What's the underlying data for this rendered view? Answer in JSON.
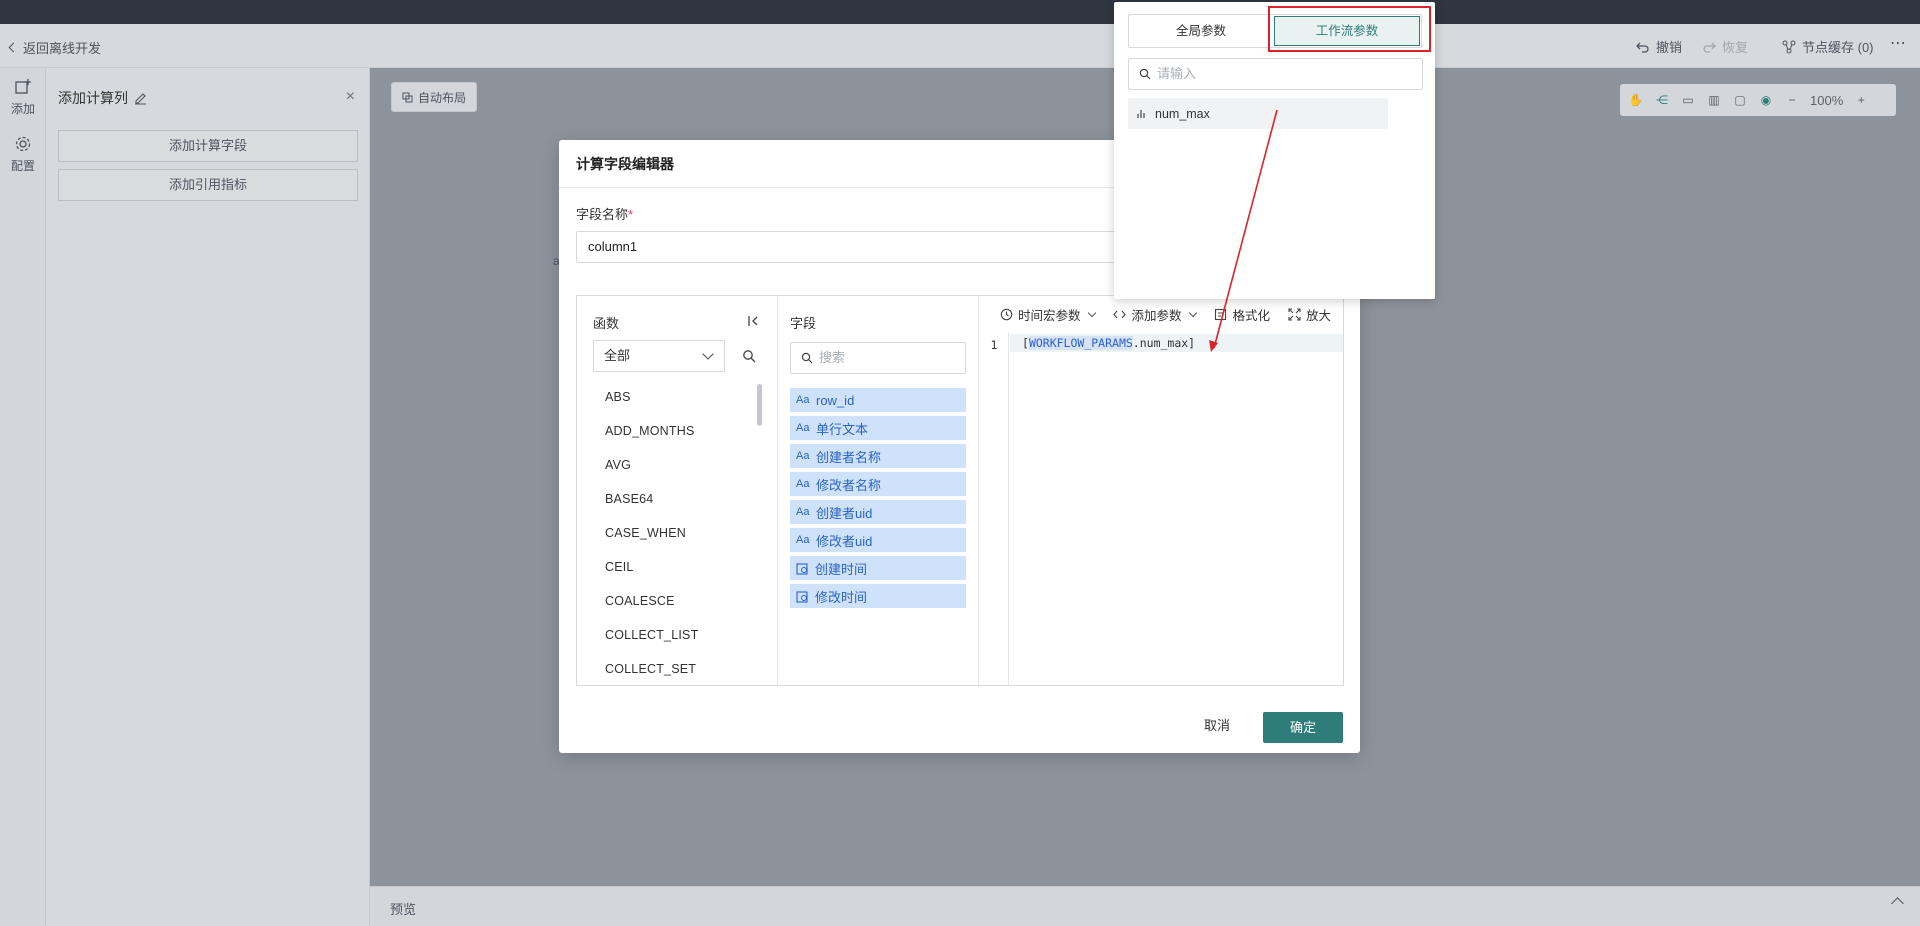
{
  "header": {
    "back_label": "返回离线开发",
    "undo_label": "撤销",
    "redo_label": "恢复",
    "node_cache_label": "节点缓存 (0)"
  },
  "rail": {
    "add_label": "添加",
    "config_label": "配置"
  },
  "left_panel": {
    "title": "添加计算列",
    "buttons": [
      "添加计算字段",
      "添加引用指标"
    ]
  },
  "canvas": {
    "auto_layout_label": "自动布局",
    "zoom_level": "100%",
    "preview_label": "预览"
  },
  "modal": {
    "title": "计算字段编辑器",
    "field_name_label": "字段名称",
    "required_mark": "*",
    "field_name_value": "column1",
    "functions": {
      "title": "函数",
      "category_selected": "全部",
      "items": [
        "ABS",
        "ADD_MONTHS",
        "AVG",
        "BASE64",
        "CASE_WHEN",
        "CEIL",
        "COALESCE",
        "COLLECT_LIST",
        "COLLECT_SET"
      ]
    },
    "fields": {
      "title": "字段",
      "search_placeholder": "搜索",
      "items": [
        {
          "type": "text",
          "label": "row_id"
        },
        {
          "type": "text",
          "label": "单行文本"
        },
        {
          "type": "text",
          "label": "创建者名称"
        },
        {
          "type": "text",
          "label": "修改者名称"
        },
        {
          "type": "text",
          "label": "创建者uid"
        },
        {
          "type": "text",
          "label": "修改者uid"
        },
        {
          "type": "time",
          "label": "创建时间"
        },
        {
          "type": "time",
          "label": "修改时间"
        }
      ],
      "text_type_glyph": "Aa"
    },
    "code": {
      "toolbar": {
        "time_macro_label": "时间宏参数",
        "add_param_label": "添加参数",
        "format_label": "格式化",
        "expand_label": "放大"
      },
      "line_number": "1",
      "code_open": "[",
      "code_keyword": "WORKFLOW_PARAMS",
      "code_rest": ".num_max]"
    },
    "cancel_label": "取消",
    "ok_label": "确定"
  },
  "popover": {
    "tabs": [
      "全局参数",
      "工作流参数"
    ],
    "active_tab": "工作流参数",
    "search_placeholder": "请输入",
    "items": [
      "num_max"
    ]
  },
  "colors": {
    "accent": "#2f7d7a",
    "highlight": "#d9252a",
    "field_chip": "#cfe2fb",
    "field_text": "#2b63c6"
  }
}
